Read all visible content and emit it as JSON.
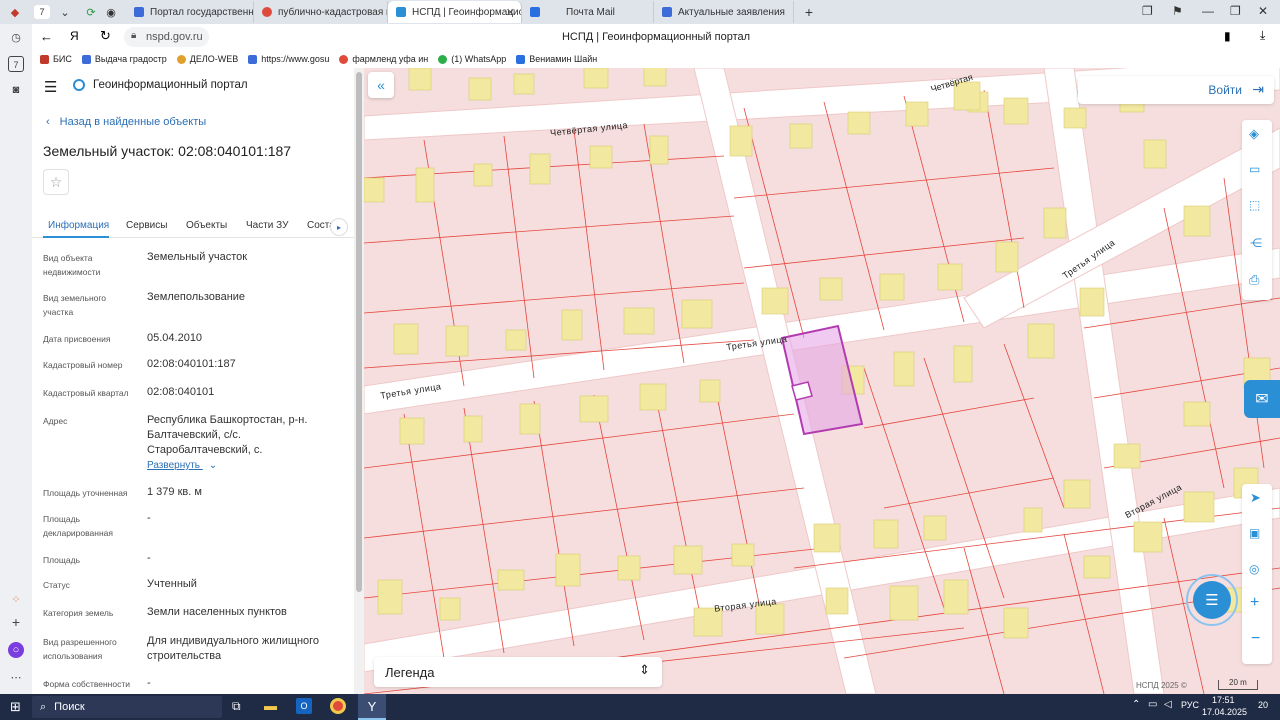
{
  "browser": {
    "tab_count": "7",
    "tabs": [
      {
        "label": "Портал государственных",
        "color": "#3d6bd8"
      },
      {
        "label": "публично-кадастровая ка",
        "color": "#e04a3a"
      },
      {
        "label": "НСПД | Геоинформацио",
        "color": "#2b8fd6"
      },
      {
        "label": "Почта Mail",
        "color": "#2b6ee0"
      },
      {
        "label": "Актуальные заявления",
        "color": "#3d6bd8"
      }
    ],
    "url": "nspd.gov.ru",
    "page_title": "НСПД | Геоинформационный портал",
    "bookmarks": [
      "БИС",
      "Выдача градостр",
      "ДЕЛО-WEB",
      "https://www.gosu",
      "фармленд уфа ин",
      "(1) WhatsApp",
      "Вениамин Шайн"
    ]
  },
  "panel": {
    "app_title": "Геоинформационный портал",
    "back_link": "Назад в найденные объекты",
    "object_title": "Земельный участок: 02:08:040101:187",
    "tabs": [
      "Информация",
      "Сервисы",
      "Объекты",
      "Части ЗУ",
      "Соста"
    ],
    "fields": [
      {
        "label": "Вид объекта недвижимости",
        "value": "Земельный участок"
      },
      {
        "label": "Вид земельного участка",
        "value": "Землепользование"
      },
      {
        "label": "Дата присвоения",
        "value": "05.04.2010"
      },
      {
        "label": "Кадастровый номер",
        "value": "02:08:040101:187"
      },
      {
        "label": "Кадастровый квартал",
        "value": "02:08:040101"
      },
      {
        "label": "Адрес",
        "value": "Республика Башкортостан, р-н. Балтачевский, с/с. Старобалтачевский, с."
      },
      {
        "label": "Площадь уточненная",
        "value": "1 379 кв. м"
      },
      {
        "label": "Площадь декларированная",
        "value": "-"
      },
      {
        "label": "Площадь",
        "value": "-"
      },
      {
        "label": "Статус",
        "value": "Учтенный"
      },
      {
        "label": "Категория земель",
        "value": "Земли населенных пунктов"
      },
      {
        "label": "Вид разрешенного использования",
        "value": "Для индивидуального жилищного строительства"
      },
      {
        "label": "Форма собственности",
        "value": "-"
      }
    ],
    "expand_link": "Развернуть"
  },
  "map": {
    "login": "Войти",
    "legend": "Легенда",
    "streets": {
      "chetvertaya_top": "Четвёртая",
      "chetvertaya": "Четвёртая улица",
      "tretya_1": "Третья улица",
      "tretya_2": "Третья улица",
      "tretya_3": "Третья улица",
      "vtoraya_1": "Вторая улица",
      "vtoraya_2": "Вторая улица"
    },
    "attribution": "НСПД 2025 ©",
    "scale": "20 m",
    "accent": "#2b8fd6",
    "parcel_color": "#b23bb0"
  },
  "taskbar": {
    "search": "Поиск",
    "lang": "РУС",
    "time": "17:51",
    "date": "17.04.2025",
    "notif": "20"
  }
}
